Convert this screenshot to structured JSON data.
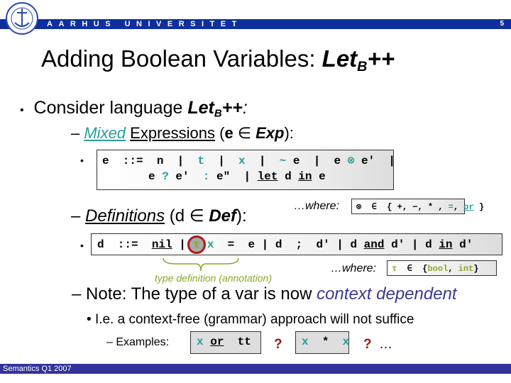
{
  "header": {
    "university": "AARHUS UNIVERSITET",
    "slide_number": "5",
    "logo_icon": "university-seal-icon",
    "band_color": "#0f2f9c"
  },
  "title": {
    "text": "Adding Boolean Variables: ",
    "lang_base": "Let",
    "lang_sub": "B",
    "lang_suffix": "++"
  },
  "bullets": {
    "consider": {
      "text": "Consider language ",
      "lang_base": "Let",
      "lang_sub": "B",
      "lang_suffix": "++",
      "colon": ":"
    },
    "expressions": {
      "dash": "– ",
      "mixed": "Mixed",
      "label": "Expressions",
      "paren_open": " (",
      "var": "e",
      "elem": " ∈ ",
      "set": "Exp",
      "paren_close": "):"
    },
    "exp_grammar": {
      "bullet": "•",
      "line1": [
        {
          "t": "e  ::=  n  |  ",
          "c": ""
        },
        {
          "t": "t",
          "c": "teal"
        },
        {
          "t": "  |  ",
          "c": ""
        },
        {
          "t": "x",
          "c": "teal"
        },
        {
          "t": "  |  ",
          "c": ""
        },
        {
          "t": "~",
          "c": "teal"
        },
        {
          "t": " e  |  e ",
          "c": ""
        },
        {
          "t": "⊗",
          "c": "teal"
        },
        {
          "t": " e′  |",
          "c": ""
        }
      ],
      "line2": [
        {
          "t": "e ",
          "c": ""
        },
        {
          "t": "?",
          "c": "teal"
        },
        {
          "t": " e′  ",
          "c": ""
        },
        {
          "t": ":",
          "c": "teal"
        },
        {
          "t": " e″  | ",
          "c": ""
        },
        {
          "t": "let",
          "c": "ul"
        },
        {
          "t": " d ",
          "c": ""
        },
        {
          "t": "in",
          "c": "ul"
        },
        {
          "t": " e",
          "c": ""
        }
      ]
    },
    "ops_where": {
      "label": "…where:",
      "box": [
        {
          "t": "⊗  ∈  { +, −, * , ",
          "c": ""
        },
        {
          "t": "=",
          "c": "teal"
        },
        {
          "t": ", ",
          "c": ""
        },
        {
          "t": "or",
          "c": "teal ul"
        },
        {
          "t": " }",
          "c": ""
        }
      ]
    },
    "definitions": {
      "dash": "– ",
      "label": "Definitions",
      "paren_open": " (d",
      "elem": " ∈ ",
      "set": "Def",
      "paren_close": "):"
    },
    "def_grammar": {
      "bullet": "•",
      "before": [
        {
          "t": "d  ::=  ",
          "c": ""
        },
        {
          "t": "nil",
          "c": "ul"
        },
        {
          "t": " |",
          "c": ""
        }
      ],
      "tau": "τ",
      "after": [
        {
          "t": "x",
          "c": "teal"
        },
        {
          "t": "  =  e | d  ;  d′ | d ",
          "c": ""
        },
        {
          "t": "and",
          "c": "ul"
        },
        {
          "t": " d′ | d ",
          "c": ""
        },
        {
          "t": "in",
          "c": "ul"
        },
        {
          "t": " d′",
          "c": ""
        }
      ],
      "annotation": "type definition (annotation)"
    },
    "types_where": {
      "label": "…where:",
      "box": [
        {
          "t": "τ",
          "c": "olive"
        },
        {
          "t": "  ∈  {",
          "c": ""
        },
        {
          "t": "bool",
          "c": "olive"
        },
        {
          "t": ", ",
          "c": ""
        },
        {
          "t": "int",
          "c": "olive"
        },
        {
          "t": "}",
          "c": ""
        }
      ]
    },
    "note": {
      "text": "– Note: The type of a var is now ",
      "emphasis": "context dependent"
    },
    "ie": {
      "bullet": "• ",
      "text": "I.e. a context-free (grammar) approach will not suffice"
    },
    "examples": {
      "label": "– Examples:",
      "box1": [
        {
          "t": "x",
          "c": "teal"
        },
        {
          "t": " ",
          "c": ""
        },
        {
          "t": "or",
          "c": "ul"
        },
        {
          "t": "  tt",
          "c": ""
        }
      ],
      "q1": "?",
      "box2": [
        {
          "t": "x",
          "c": "teal"
        },
        {
          "t": "  *  ",
          "c": ""
        },
        {
          "t": "x",
          "c": "teal"
        }
      ],
      "q2": "?",
      "ellipsis": " …"
    }
  },
  "footer": {
    "text": "Semantics Q1 2007",
    "band_color": "#333399"
  }
}
